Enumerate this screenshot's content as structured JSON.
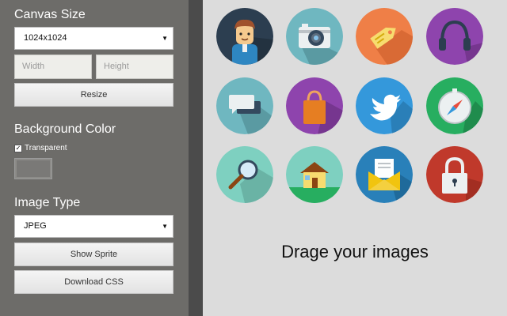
{
  "sidebar": {
    "canvas_size": {
      "title": "Canvas Size",
      "selected": "1024x1024",
      "width_placeholder": "Width",
      "height_placeholder": "Height",
      "resize_label": "Resize"
    },
    "background_color": {
      "title": "Background Color",
      "transparent_label": "Transparent",
      "transparent_checked": true,
      "swatch_color": "#7a7977"
    },
    "image_type": {
      "title": "Image Type",
      "selected": "JPEG",
      "show_sprite_label": "Show Sprite",
      "download_css_label": "Download CSS"
    }
  },
  "workspace": {
    "drop_text": "Drage your images",
    "icons": [
      {
        "name": "user-avatar-icon",
        "color": "#2c3e50"
      },
      {
        "name": "camera-icon",
        "color": "#6fb7c0"
      },
      {
        "name": "price-tag-icon",
        "color": "#ef7f47"
      },
      {
        "name": "headphones-icon",
        "color": "#8e44ad"
      },
      {
        "name": "chat-bubbles-icon",
        "color": "#6fb7c0"
      },
      {
        "name": "shopping-bag-icon",
        "color": "#8e44ad"
      },
      {
        "name": "twitter-bird-icon",
        "color": "#3498db"
      },
      {
        "name": "compass-icon",
        "color": "#27ae60"
      },
      {
        "name": "magnifier-icon",
        "color": "#7ed0c0"
      },
      {
        "name": "home-icon",
        "color": "#7ed0c0"
      },
      {
        "name": "mail-icon",
        "color": "#2980b9"
      },
      {
        "name": "padlock-icon",
        "color": "#c0392b"
      }
    ]
  }
}
